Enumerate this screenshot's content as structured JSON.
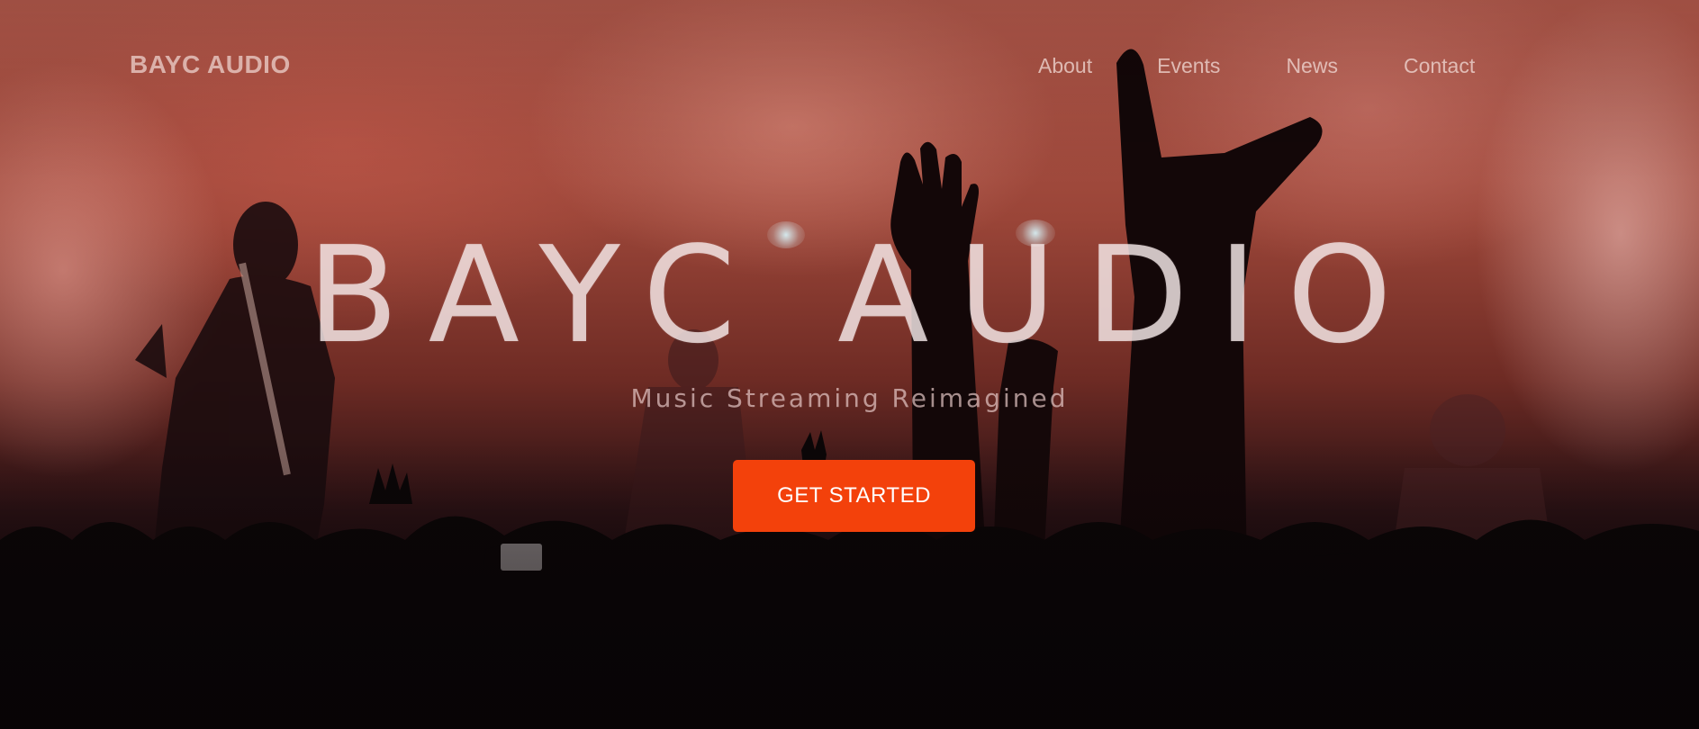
{
  "header": {
    "brand": "BAYC AUDIO",
    "nav": [
      "About",
      "Events",
      "News",
      "Contact"
    ]
  },
  "hero": {
    "title": "BAYC AUDIO",
    "tagline": "Music Streaming Reimagined",
    "cta_label": "GET STARTED",
    "background_image": "concert-crowd-photo"
  },
  "colors": {
    "accent": "#f3410b",
    "text_light": "#f5e8e8",
    "haze_red": "#9a4538",
    "shadow": "#070506"
  }
}
